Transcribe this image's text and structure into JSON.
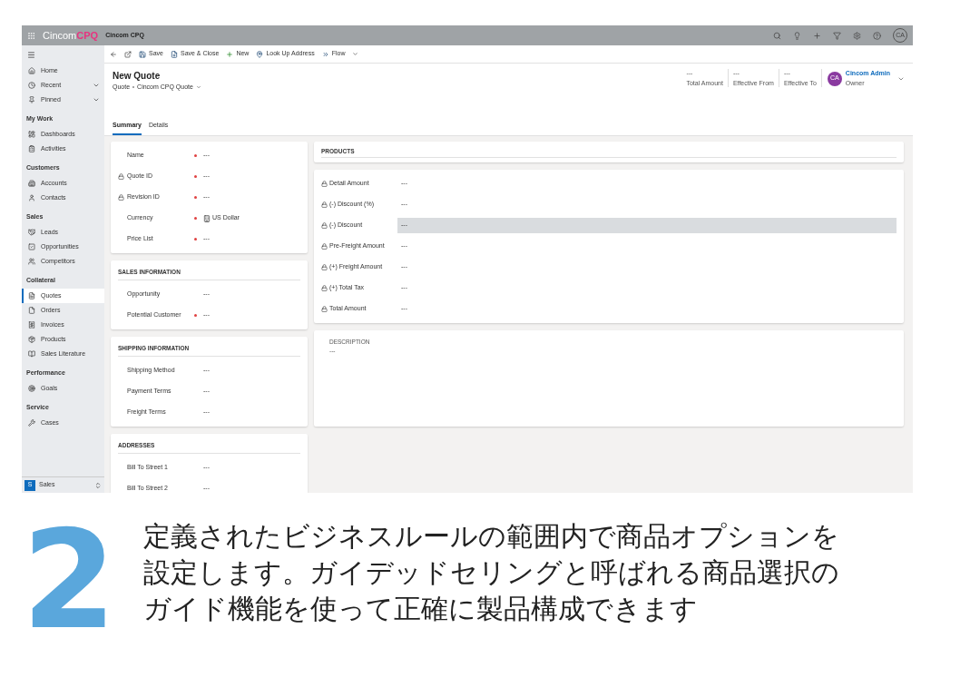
{
  "app": {
    "brand": {
      "part1": "Cincom",
      "part2": "CPQ"
    },
    "app_name": "Cincom CPQ",
    "user_initials": "CA"
  },
  "sidebar": {
    "groups": [
      {
        "items": [
          {
            "label": "Home",
            "selected": false
          },
          {
            "label": "Recent",
            "selected": false,
            "expanded": false
          },
          {
            "label": "Pinned",
            "selected": false,
            "expanded": false
          }
        ]
      },
      {
        "heading": "My Work",
        "items": [
          {
            "label": "Dashboards",
            "selected": false
          },
          {
            "label": "Activities",
            "selected": false
          }
        ]
      },
      {
        "heading": "Customers",
        "items": [
          {
            "label": "Accounts",
            "selected": false
          },
          {
            "label": "Contacts",
            "selected": false
          }
        ]
      },
      {
        "heading": "Sales",
        "items": [
          {
            "label": "Leads",
            "selected": false
          },
          {
            "label": "Opportunities",
            "selected": false
          },
          {
            "label": "Competitors",
            "selected": false
          }
        ]
      },
      {
        "heading": "Collateral",
        "items": [
          {
            "label": "Quotes",
            "selected": true
          },
          {
            "label": "Orders",
            "selected": false
          },
          {
            "label": "Invoices",
            "selected": false
          },
          {
            "label": "Products",
            "selected": false
          },
          {
            "label": "Sales Literature",
            "selected": false
          }
        ]
      },
      {
        "heading": "Performance",
        "items": [
          {
            "label": "Goals",
            "selected": false
          }
        ]
      },
      {
        "heading": "Service",
        "items": [
          {
            "label": "Cases",
            "selected": false
          }
        ]
      }
    ],
    "area": {
      "badge": "S",
      "label": "Sales"
    }
  },
  "toolbar": [
    {
      "label": "Save",
      "kind": "button"
    },
    {
      "label": "Save & Close",
      "kind": "button"
    },
    {
      "label": "New",
      "kind": "button"
    },
    {
      "label": "Look Up Address",
      "kind": "button"
    },
    {
      "label": "Flow",
      "kind": "dropdown"
    }
  ],
  "record": {
    "title": "New Quote",
    "breadcrumb": [
      "Quote",
      "Cincom CPQ Quote"
    ],
    "header_fields": [
      {
        "value": "---",
        "label": "Total Amount"
      },
      {
        "value": "---",
        "label": "Effective From"
      },
      {
        "value": "---",
        "label": "Effective To"
      }
    ],
    "owner": {
      "initials": "CA",
      "name": "Cincom Admin",
      "role": "Owner"
    }
  },
  "tabs": [
    {
      "label": "Summary",
      "selected": true
    },
    {
      "label": "Details",
      "selected": false
    }
  ],
  "left_sections": [
    {
      "fields": [
        {
          "label": "Name",
          "locked": false,
          "required": true,
          "value": "---"
        },
        {
          "label": "Quote ID",
          "locked": true,
          "required": true,
          "value": "---"
        },
        {
          "label": "Revision ID",
          "locked": true,
          "required": true,
          "value": "---"
        },
        {
          "label": "Currency",
          "locked": false,
          "required": true,
          "value": "US Dollar",
          "kind": "lookup"
        },
        {
          "label": "Price List",
          "locked": false,
          "required": true,
          "value": "---"
        }
      ]
    },
    {
      "title": "SALES INFORMATION",
      "fields": [
        {
          "label": "Opportunity",
          "locked": false,
          "required": false,
          "value": "---"
        },
        {
          "label": "Potential Customer",
          "locked": false,
          "required": true,
          "value": "---"
        }
      ]
    },
    {
      "title": "SHIPPING INFORMATION",
      "fields": [
        {
          "label": "Shipping Method",
          "locked": false,
          "required": false,
          "value": "---"
        },
        {
          "label": "Payment Terms",
          "locked": false,
          "required": false,
          "value": "---"
        },
        {
          "label": "Freight Terms",
          "locked": false,
          "required": false,
          "value": "---"
        }
      ]
    },
    {
      "title": "ADDRESSES",
      "fields": [
        {
          "label": "Bill To Street 1",
          "locked": false,
          "required": false,
          "value": "---"
        },
        {
          "label": "Bill To Street 2",
          "locked": false,
          "required": false,
          "value": "---"
        }
      ]
    }
  ],
  "products": {
    "title": "PRODUCTS"
  },
  "totals": [
    {
      "label": "Detail Amount",
      "locked": true,
      "value": "---",
      "selected": false
    },
    {
      "label": "(-) Discount (%)",
      "locked": true,
      "value": "---",
      "selected": false
    },
    {
      "label": "(-) Discount",
      "locked": true,
      "value": "---",
      "selected": true
    },
    {
      "label": "Pre-Freight Amount",
      "locked": true,
      "value": "---",
      "selected": false
    },
    {
      "label": "(+) Freight Amount",
      "locked": true,
      "value": "---",
      "selected": false
    },
    {
      "label": "(+) Total Tax",
      "locked": true,
      "value": "---",
      "selected": false
    },
    {
      "label": "Total Amount",
      "locked": true,
      "value": "---",
      "selected": false
    }
  ],
  "description": {
    "label": "DESCRIPTION",
    "value": "---"
  },
  "caption": {
    "number": "2",
    "lines": [
      "定義されたビジネスルールの範囲内で商品オプションを",
      "設定します。ガイデッドセリングと呼ばれる商品選択の",
      "ガイド機能を使って正確に製品構成できます"
    ]
  }
}
